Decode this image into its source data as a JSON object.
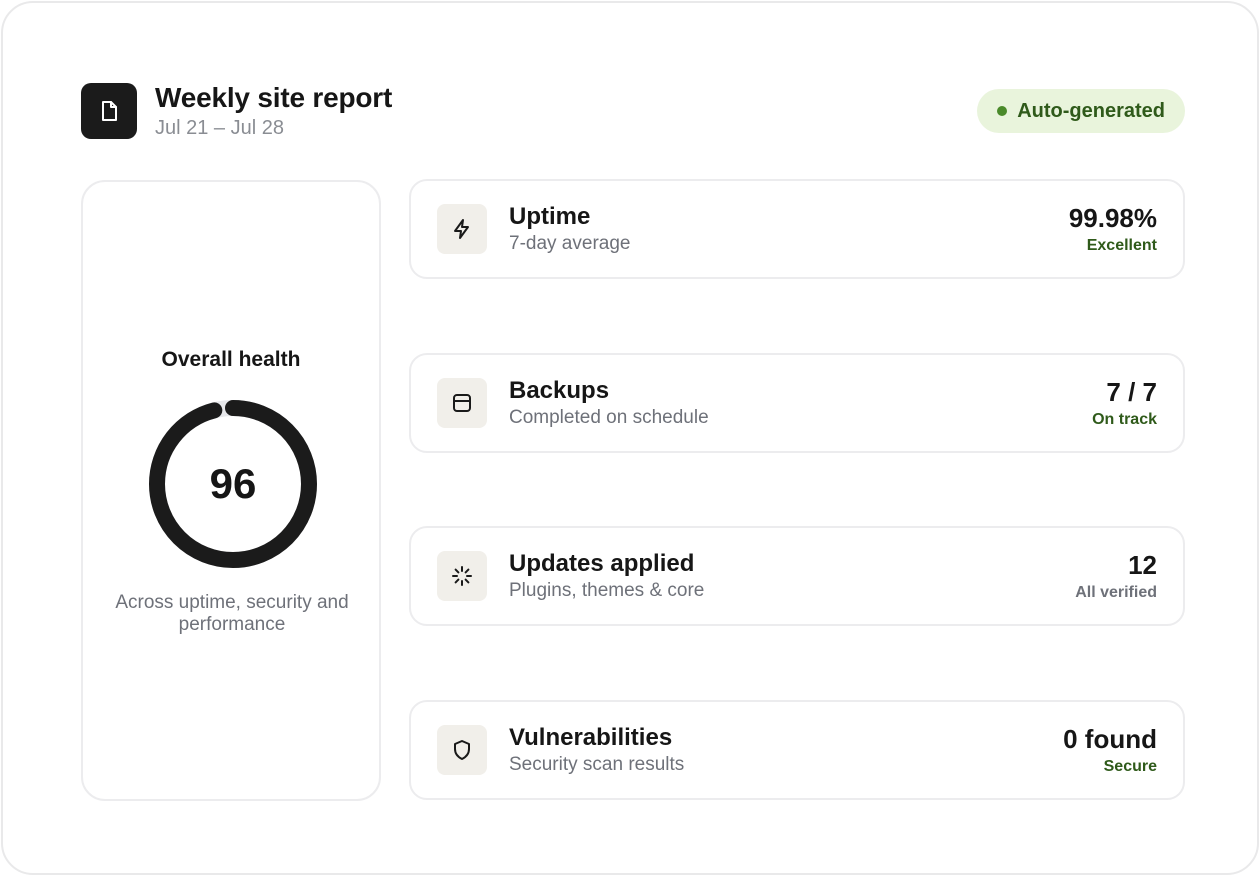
{
  "header": {
    "title": "Weekly site report",
    "date_range": "Jul 21 – Jul 28",
    "badge": "Auto-generated",
    "logo_icon": "document-icon"
  },
  "health": {
    "title": "Overall health",
    "score": "96",
    "score_fraction": 0.96,
    "caption": "Across uptime, security and performance"
  },
  "metrics": [
    {
      "icon": "lightning-icon",
      "label": "Uptime",
      "sub": "7-day average",
      "value": "99.98%",
      "status": "Excellent",
      "tone": "good"
    },
    {
      "icon": "window-icon",
      "label": "Backups",
      "sub": "Completed on schedule",
      "value": "7 / 7",
      "status": "On track",
      "tone": "good"
    },
    {
      "icon": "loader-icon",
      "label": "Updates applied",
      "sub": "Plugins, themes & core",
      "value": "12",
      "status": "All verified",
      "tone": "neutral"
    },
    {
      "icon": "shield-icon",
      "label": "Vulnerabilities",
      "sub": "Security scan results",
      "value": "0 found",
      "status": "Secure",
      "tone": "good"
    }
  ],
  "colors": {
    "ring_fill": "#1b1b1b",
    "ring_track": "#e6e7ea",
    "badge_bg": "#e9f4dc",
    "badge_text": "#2f5a1a",
    "status_good": "#2f5a1a",
    "status_neutral": "#6e7179",
    "icon_tile_bg": "#f1efea"
  }
}
